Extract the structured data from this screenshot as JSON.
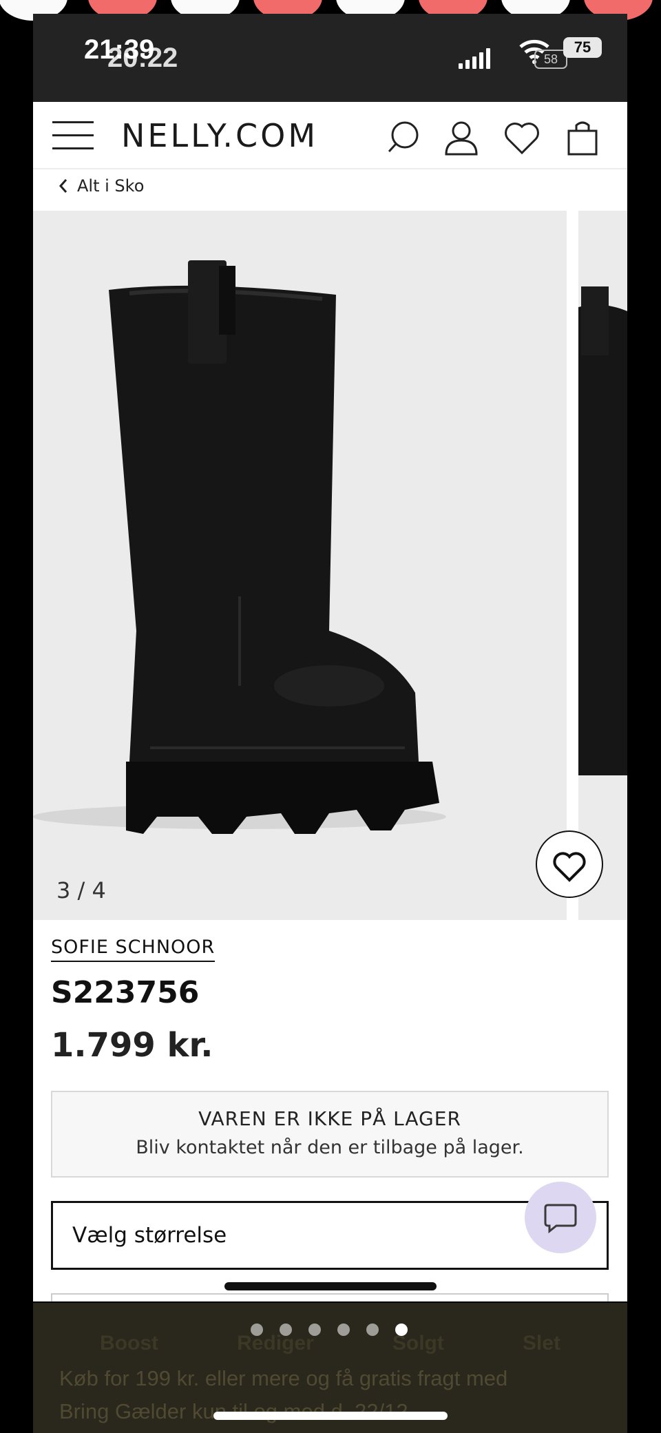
{
  "status_bar": {
    "time_front": "21:39",
    "time_back": "20:22",
    "battery": "75",
    "battery_back": "58"
  },
  "header": {
    "logo": "NELLY.COM",
    "icons": [
      "menu-icon",
      "search-icon",
      "user-icon",
      "heart-icon",
      "bag-icon"
    ]
  },
  "breadcrumb": {
    "label": "Alt i Sko"
  },
  "gallery": {
    "counter": "3 / 4"
  },
  "product": {
    "brand": "SOFIE SCHNOOR",
    "model": "S223756",
    "price": "1.799 kr."
  },
  "stock_notice": {
    "title": "VAREN ER IKKE PÅ LAGER",
    "subtitle": "Bliv kontaktet når den er tilbage på lager."
  },
  "size_select": {
    "label": "Vælg størrelse"
  },
  "bottom_bar": {
    "actions": [
      "Boost",
      "Rediger",
      "Solgt",
      "Slet"
    ],
    "promo_line1": "Køb for 199 kr. eller mere og få gratis fragt med",
    "promo_line2": "Bring Gælder kun til og med d. 22/12"
  },
  "colors": {
    "chat_bubble": "#ddd7f1",
    "story_red": "#f26b6b",
    "status_bar_bg": "#232323"
  }
}
